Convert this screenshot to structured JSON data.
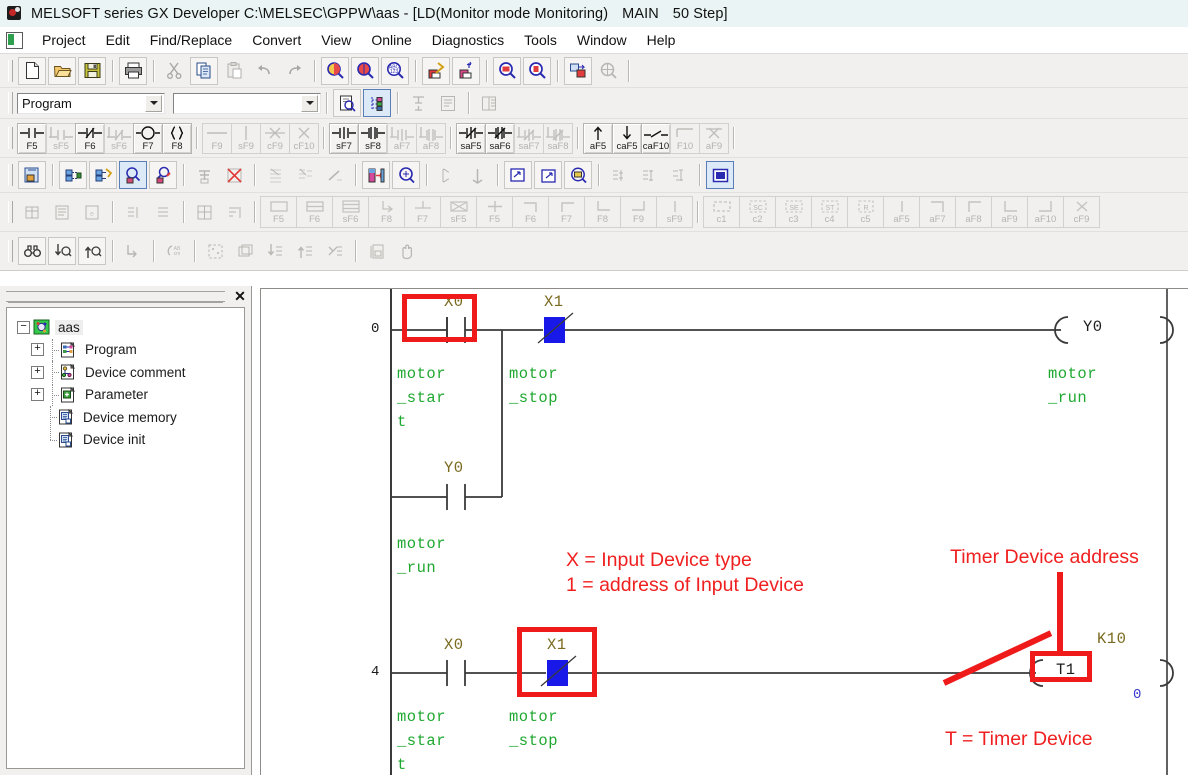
{
  "window": {
    "title_main": "MELSOFT series GX Developer C:\\MELSEC\\GPPW\\aas - [LD(Monitor mode Monitoring)",
    "title_mode": "MAIN",
    "title_steps": "50 Step]",
    "app_icon": "melsoft-icon"
  },
  "menu": {
    "icon": "document-icon",
    "items": [
      {
        "label": "Project"
      },
      {
        "label": "Edit"
      },
      {
        "label": "Find/Replace"
      },
      {
        "label": "Convert"
      },
      {
        "label": "View"
      },
      {
        "label": "Online"
      },
      {
        "label": "Diagnostics"
      },
      {
        "label": "Tools"
      },
      {
        "label": "Window"
      },
      {
        "label": "Help"
      }
    ]
  },
  "toolbar_standard": {
    "buttons": [
      {
        "name": "new-icon",
        "tip": "New"
      },
      {
        "name": "open-folder-icon",
        "tip": "Open"
      },
      {
        "name": "save-disk-icon",
        "tip": "Save"
      },
      {
        "name": "print-icon",
        "tip": "Print"
      },
      {
        "name": "cut-scissors-icon",
        "tip": "Cut",
        "disabled": true
      },
      {
        "name": "copy-icon",
        "tip": "Copy"
      },
      {
        "name": "paste-icon",
        "tip": "Paste",
        "disabled": true
      },
      {
        "name": "undo-arrow-icon",
        "tip": "Undo",
        "disabled": true
      },
      {
        "name": "redo-arrow-icon",
        "tip": "Redo",
        "disabled": true
      },
      {
        "name": "find-device-icon",
        "tip": "Find device"
      },
      {
        "name": "find-instruction-icon",
        "tip": "Find instruction"
      },
      {
        "name": "find-abc123-icon",
        "tip": "Find character string"
      },
      {
        "name": "write-to-plc-icon",
        "tip": "Write to PLC"
      },
      {
        "name": "monitor-start-icon",
        "tip": "Monitor start"
      },
      {
        "name": "zoom-in-icon",
        "tip": "Zoom in"
      },
      {
        "name": "zoom-out-icon",
        "tip": "Zoom out"
      },
      {
        "name": "device-edit-icon",
        "tip": "Device edit"
      },
      {
        "name": "global-search-icon",
        "tip": "Cross reference",
        "disabled": true
      }
    ]
  },
  "toolbar_program": {
    "program_select": {
      "value": "Program",
      "placeholder": "Program"
    },
    "block_select": {
      "value": "",
      "placeholder": ""
    },
    "buttons": [
      {
        "name": "program-check-icon"
      },
      {
        "name": "project-tree-icon",
        "active": true
      },
      {
        "name": "ladder-merge-icon",
        "disabled": true
      },
      {
        "name": "ladder-compare-icon",
        "disabled": true
      },
      {
        "name": "list-view-icon",
        "disabled": true
      }
    ]
  },
  "toolbar_ladder": {
    "groups": [
      {
        "buttons": [
          {
            "sym": "no-contact",
            "key": "F5",
            "disabled": false
          },
          {
            "sym": "no-contact-or",
            "key": "sF5",
            "disabled": true
          },
          {
            "sym": "nc-contact",
            "key": "F6",
            "disabled": false
          },
          {
            "sym": "nc-contact-or",
            "key": "sF6",
            "disabled": true
          },
          {
            "sym": "coil",
            "key": "F7",
            "disabled": false
          },
          {
            "sym": "application-instruction",
            "key": "F8",
            "disabled": false
          }
        ]
      },
      {
        "buttons": [
          {
            "sym": "h-line",
            "key": "F9",
            "disabled": true
          },
          {
            "sym": "v-line",
            "key": "sF9",
            "disabled": true
          },
          {
            "sym": "delete-h-line",
            "key": "cF9",
            "disabled": true
          },
          {
            "sym": "delete-v-line",
            "key": "cF10",
            "disabled": true
          }
        ]
      },
      {
        "buttons": [
          {
            "sym": "rising-pulse",
            "key": "sF7",
            "disabled": false
          },
          {
            "sym": "falling-pulse",
            "key": "sF8",
            "disabled": false
          },
          {
            "sym": "rising-pulse-or",
            "key": "aF7",
            "disabled": true
          },
          {
            "sym": "falling-pulse-or",
            "key": "aF8",
            "disabled": true
          }
        ]
      },
      {
        "buttons": [
          {
            "sym": "pulse-not-rising",
            "key": "saF5",
            "disabled": false
          },
          {
            "sym": "pulse-not-falling",
            "key": "saF6",
            "disabled": false
          },
          {
            "sym": "pulse-not-rising-or",
            "key": "saF7",
            "disabled": true
          },
          {
            "sym": "pulse-not-falling-or",
            "key": "saF8",
            "disabled": true
          }
        ]
      },
      {
        "buttons": [
          {
            "sym": "arrow-up",
            "key": "aF5",
            "disabled": false
          },
          {
            "sym": "arrow-down",
            "key": "caF5",
            "disabled": false
          },
          {
            "sym": "invert-operation",
            "key": "caF10",
            "disabled": false
          },
          {
            "sym": "compile-bar",
            "key": "F10",
            "disabled": true
          },
          {
            "sym": "compile-x",
            "key": "aF9",
            "disabled": true
          }
        ]
      }
    ]
  },
  "toolbar_monitor": {
    "buttons": [
      {
        "name": "program-copy-icon"
      },
      {
        "name": "device-batch-monitor-icon"
      },
      {
        "name": "entry-data-monitor-icon"
      },
      {
        "name": "monitor-mode-icon",
        "active": true
      },
      {
        "name": "monitor-write-mode-icon"
      },
      {
        "name": "monitor-stop-icon",
        "disabled": true
      },
      {
        "name": "monitor-stop-all-icon",
        "disabled": true
      },
      {
        "name": "step-run-icon",
        "disabled": true
      },
      {
        "name": "partial-run-icon",
        "disabled": true
      },
      {
        "name": "skip-run-icon",
        "disabled": true
      },
      {
        "name": "device-test-icon"
      },
      {
        "name": "search-device-icon"
      },
      {
        "name": "clear-device-icon",
        "disabled": true
      },
      {
        "name": "clear-all-device-icon",
        "disabled": true
      },
      {
        "name": "open-window-icon"
      },
      {
        "name": "new-window-icon"
      },
      {
        "name": "remote-operation-icon"
      },
      {
        "name": "ladder-edit-1-icon",
        "disabled": true
      },
      {
        "name": "ladder-edit-2-icon",
        "disabled": true
      },
      {
        "name": "ladder-edit-3-icon",
        "disabled": true
      },
      {
        "name": "display-screen-icon",
        "active": true
      }
    ]
  },
  "toolbar_sfc": {
    "left_buttons": [
      {
        "name": "sfc-block-icon",
        "disabled": true
      },
      {
        "name": "sfc-program-icon",
        "disabled": true
      },
      {
        "name": "sfc-error-icon",
        "disabled": true
      },
      {
        "name": "sfc-step-icon",
        "disabled": true
      },
      {
        "name": "sfc-list-icon",
        "disabled": true
      },
      {
        "name": "sfc-grid-icon",
        "disabled": true
      },
      {
        "name": "sfc-sort-icon",
        "disabled": true
      }
    ],
    "key_buttons": [
      {
        "sym": "sfc-step",
        "key": "F5"
      },
      {
        "sym": "sfc-block-start",
        "key": "F6"
      },
      {
        "sym": "sfc-dummy",
        "key": "sF6"
      },
      {
        "sym": "sfc-jump",
        "key": "F8"
      },
      {
        "sym": "sfc-end",
        "key": "F7"
      },
      {
        "sym": "sfc-transition",
        "key": "sF5"
      },
      {
        "sym": "sfc-selection-div",
        "key": "F5"
      },
      {
        "sym": "sfc-selection-cpl",
        "key": "F6"
      },
      {
        "sym": "sfc-parallel-div",
        "key": "F7"
      },
      {
        "sym": "sfc-parallel-cpl",
        "key": "F8"
      },
      {
        "sym": "sfc-vertical",
        "key": "F9"
      },
      {
        "sym": "sfc-vertical-2",
        "key": "sF9"
      }
    ],
    "key_buttons2": [
      {
        "sym": "sfc-c1",
        "key": "c1"
      },
      {
        "sym": "sfc-sc",
        "key": "c2"
      },
      {
        "sym": "sfc-se",
        "key": "c3"
      },
      {
        "sym": "sfc-st",
        "key": "c4"
      },
      {
        "sym": "sfc-r",
        "key": "c5"
      },
      {
        "sym": "sfc-line-af5",
        "key": "aF5"
      },
      {
        "sym": "sfc-line-af7",
        "key": "aF7"
      },
      {
        "sym": "sfc-line-af8",
        "key": "aF8"
      },
      {
        "sym": "sfc-line-af9",
        "key": "aF9"
      },
      {
        "sym": "sfc-line-af10",
        "key": "aF10"
      },
      {
        "sym": "sfc-del-cf9",
        "key": "cF9"
      }
    ]
  },
  "toolbar_find": {
    "buttons": [
      {
        "name": "find-binoculars-icon"
      },
      {
        "name": "find-next-icon"
      },
      {
        "name": "find-previous-icon"
      },
      {
        "name": "jump-icon",
        "disabled": true
      },
      {
        "name": "device-comment-icon",
        "disabled": true
      },
      {
        "name": "select-all-icon",
        "disabled": true
      },
      {
        "name": "layer-icon",
        "disabled": true
      },
      {
        "name": "move-down-icon",
        "disabled": true
      },
      {
        "name": "move-up-icon",
        "disabled": true
      },
      {
        "name": "cut-link-icon",
        "disabled": true
      },
      {
        "name": "save-block-icon",
        "disabled": true
      },
      {
        "name": "hand-tool-icon",
        "disabled": true
      }
    ]
  },
  "project_panel": {
    "close_label": "✕",
    "tree": [
      {
        "label": "aas",
        "icon": "project-root-icon",
        "toggle": "−",
        "level": 0,
        "selected": true
      },
      {
        "label": "Program",
        "icon": "program-folder-icon",
        "toggle": "+",
        "level": 1
      },
      {
        "label": "Device comment",
        "icon": "device-comment-icon",
        "toggle": "+",
        "level": 1
      },
      {
        "label": "Parameter",
        "icon": "parameter-icon",
        "toggle": "+",
        "level": 1
      },
      {
        "label": "Device memory",
        "icon": "device-memory-icon",
        "toggle": "",
        "level": 1
      },
      {
        "label": "Device init",
        "icon": "device-init-icon",
        "toggle": "",
        "level": 1
      }
    ]
  },
  "ladder": {
    "rungs": [
      {
        "step": "0",
        "contacts": [
          {
            "device": "X0",
            "comment_lines": [
              "motor",
              "_star",
              "t"
            ],
            "type": "no",
            "state": "off",
            "highlighted": true
          },
          {
            "device": "X1",
            "comment_lines": [
              "motor",
              "_stop"
            ],
            "type": "nc",
            "state": "on"
          }
        ],
        "branch": {
          "device": "Y0",
          "comment_lines": [
            "motor",
            "_run"
          ],
          "type": "no",
          "state": "off"
        },
        "output": {
          "device": "Y0",
          "comment_lines": [
            "motor",
            "_run"
          ],
          "type": "coil"
        }
      },
      {
        "step": "4",
        "contacts": [
          {
            "device": "X0",
            "comment_lines": [
              "motor",
              "_star",
              "t"
            ],
            "type": "no",
            "state": "off"
          },
          {
            "device": "X1",
            "comment_lines": [
              "motor",
              "_stop"
            ],
            "type": "nc",
            "state": "on",
            "highlighted": true
          }
        ],
        "output": {
          "device": "T1",
          "setpoint": "K10",
          "present_value": "0",
          "type": "timer",
          "highlighted": true
        }
      }
    ]
  },
  "annotations": {
    "input_device_line1": "X = Input Device type",
    "input_device_line2": "1 = address of Input Device",
    "timer_address": "Timer Device  address",
    "timer_device": "T = Timer Device"
  },
  "colors": {
    "annotation_red": "#f02020",
    "device_label": "#7a6a1f",
    "comment_green": "#1fa82f",
    "monitor_on_blue": "#1818e8",
    "present_value_blue": "#3a3ad0",
    "titlebar_bg": "#eaf4f4",
    "toolbar_bg": "#f1f0ee"
  }
}
